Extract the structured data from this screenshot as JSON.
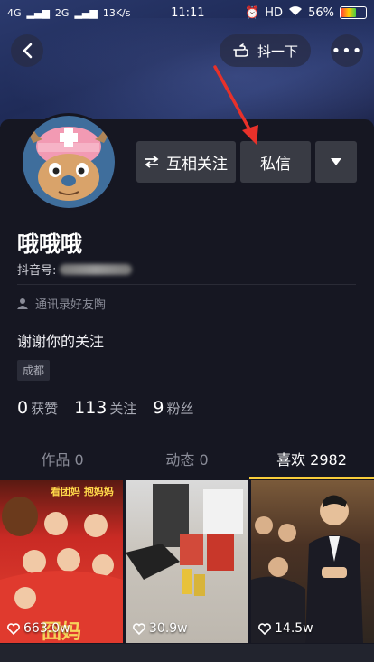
{
  "status_bar": {
    "carrier1": "4G",
    "carrier2": "2G",
    "speed": "13K/s",
    "time": "11:11",
    "hd": "HD",
    "battery": "56%",
    "battery_level": 0.56
  },
  "header": {
    "shake_label": "抖一下",
    "more_label": "•••"
  },
  "profile": {
    "mutual_follow_label": "互相关注",
    "message_label": "私信",
    "nickname": "哦哦哦",
    "douyin_id_label": "抖音号:",
    "contact_tag": "通讯录好友陶",
    "bio": "谢谢你的关注",
    "city": "成都"
  },
  "stats": [
    {
      "num": "0",
      "label": "获赞"
    },
    {
      "num": "113",
      "label": "关注"
    },
    {
      "num": "9",
      "label": "粉丝"
    }
  ],
  "tabs": [
    {
      "label": "作品 0"
    },
    {
      "label": "动态 0"
    },
    {
      "label": "喜欢 2982"
    }
  ],
  "grid": [
    {
      "likes": "663.0w",
      "poster_top": "看团妈 抱妈妈",
      "poster_bottom": "囧妈"
    },
    {
      "likes": "30.9w"
    },
    {
      "likes": "14.5w"
    }
  ],
  "colors": {
    "background": "#161722",
    "tab_indicator": "#f9ce3a",
    "button": "#393b44",
    "arrow": "#e8312a"
  }
}
